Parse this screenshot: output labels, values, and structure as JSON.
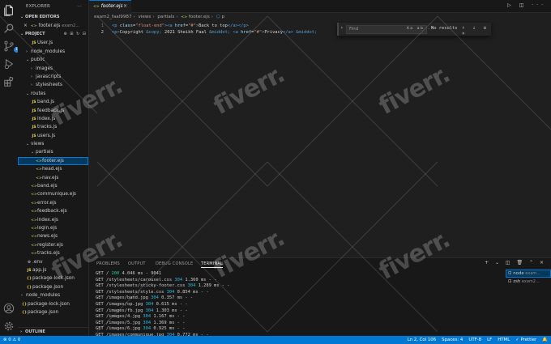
{
  "activity": {
    "items": [
      "files-icon",
      "search-icon",
      "source-control-icon",
      "run-debug-icon",
      "extensions-icon"
    ],
    "bottom": [
      "account-icon",
      "settings-gear-icon"
    ],
    "badge": "1"
  },
  "explorer": {
    "title": "EXPLORER",
    "more": "···",
    "open_editors_label": "OPEN EDITORS",
    "open_editor": {
      "close": "×",
      "name": "footer.ejs",
      "path": "exam2..."
    },
    "project_label": "PROJECT",
    "outline_label": "OUTLINE",
    "tree": [
      {
        "name": "User.js",
        "icon": "JS",
        "kind": "js",
        "depth": 2,
        "chev": ""
      },
      {
        "name": "node_modules",
        "icon": "",
        "kind": "folder",
        "depth": 1,
        "chev": "›"
      },
      {
        "name": "public",
        "icon": "",
        "kind": "folder",
        "depth": 1,
        "chev": "⌄"
      },
      {
        "name": "images",
        "icon": "",
        "kind": "folder",
        "depth": 2,
        "chev": "›"
      },
      {
        "name": "javascripts",
        "icon": "",
        "kind": "folder",
        "depth": 2,
        "chev": "›"
      },
      {
        "name": "stylesheets",
        "icon": "",
        "kind": "folder",
        "depth": 2,
        "chev": "›"
      },
      {
        "name": "routes",
        "icon": "",
        "kind": "folder",
        "depth": 1,
        "chev": "⌄"
      },
      {
        "name": "band.js",
        "icon": "JS",
        "kind": "js",
        "depth": 2,
        "chev": ""
      },
      {
        "name": "feedback.js",
        "icon": "JS",
        "kind": "js",
        "depth": 2,
        "chev": ""
      },
      {
        "name": "index.js",
        "icon": "JS",
        "kind": "js",
        "depth": 2,
        "chev": ""
      },
      {
        "name": "tracks.js",
        "icon": "JS",
        "kind": "js",
        "depth": 2,
        "chev": ""
      },
      {
        "name": "users.js",
        "icon": "JS",
        "kind": "js",
        "depth": 2,
        "chev": ""
      },
      {
        "name": "views",
        "icon": "",
        "kind": "folder",
        "depth": 1,
        "chev": "⌄"
      },
      {
        "name": "partials",
        "icon": "",
        "kind": "folder",
        "depth": 2,
        "chev": "⌄"
      },
      {
        "name": "footer.ejs",
        "icon": "<>",
        "kind": "ejs",
        "depth": 3,
        "chev": "",
        "selected": true
      },
      {
        "name": "head.ejs",
        "icon": "<>",
        "kind": "ejs",
        "depth": 3,
        "chev": ""
      },
      {
        "name": "nav.ejs",
        "icon": "<>",
        "kind": "ejs",
        "depth": 3,
        "chev": ""
      },
      {
        "name": "band.ejs",
        "icon": "<>",
        "kind": "ejs",
        "depth": 2,
        "chev": ""
      },
      {
        "name": "communique.ejs",
        "icon": "<>",
        "kind": "ejs",
        "depth": 2,
        "chev": ""
      },
      {
        "name": "error.ejs",
        "icon": "<>",
        "kind": "ejs",
        "depth": 2,
        "chev": ""
      },
      {
        "name": "feedback.ejs",
        "icon": "<>",
        "kind": "ejs",
        "depth": 2,
        "chev": ""
      },
      {
        "name": "index.ejs",
        "icon": "<>",
        "kind": "ejs",
        "depth": 2,
        "chev": ""
      },
      {
        "name": "login.ejs",
        "icon": "<>",
        "kind": "ejs",
        "depth": 2,
        "chev": ""
      },
      {
        "name": "news.ejs",
        "icon": "<>",
        "kind": "ejs",
        "depth": 2,
        "chev": ""
      },
      {
        "name": "register.ejs",
        "icon": "<>",
        "kind": "ejs",
        "depth": 2,
        "chev": ""
      },
      {
        "name": "tracks.ejs",
        "icon": "<>",
        "kind": "ejs",
        "depth": 2,
        "chev": ""
      },
      {
        "name": ".env",
        "icon": "⚙",
        "kind": "env",
        "depth": 1,
        "chev": ""
      },
      {
        "name": "app.js",
        "icon": "JS",
        "kind": "js",
        "depth": 1,
        "chev": ""
      },
      {
        "name": "package-lock.json",
        "icon": "{}",
        "kind": "json",
        "depth": 1,
        "chev": ""
      },
      {
        "name": "package.json",
        "icon": "{}",
        "kind": "json",
        "depth": 1,
        "chev": ""
      },
      {
        "name": "node_modules",
        "icon": "",
        "kind": "folder",
        "depth": 0,
        "chev": "›"
      },
      {
        "name": "package-lock.json",
        "icon": "{}",
        "kind": "json",
        "depth": 0,
        "chev": ""
      },
      {
        "name": "package.json",
        "icon": "{}",
        "kind": "json",
        "depth": 0,
        "chev": ""
      }
    ]
  },
  "tab": {
    "icon": "<>",
    "name": "footer.ejs",
    "close": "×"
  },
  "tab_actions": "▷ ◫ ···",
  "breadcrumb": [
    "exam2_faal9987",
    "views",
    "partials",
    "footer.ejs",
    "p"
  ],
  "editor": {
    "lines": [
      {
        "num": "1",
        "parts": [
          [
            "tag",
            "<p "
          ],
          [
            "attr",
            "class"
          ],
          [
            "txt",
            "="
          ],
          [
            "str",
            "\"float-end\""
          ],
          [
            "tag",
            "><a "
          ],
          [
            "attr",
            "href"
          ],
          [
            "txt",
            "="
          ],
          [
            "str",
            "\"#\""
          ],
          [
            "tag",
            ">"
          ],
          [
            "txt",
            "Back to top"
          ],
          [
            "tag",
            "</a></p>"
          ]
        ]
      },
      {
        "num": "2",
        "parts": [
          [
            "tag",
            "<p>"
          ],
          [
            "txt",
            "Copyright "
          ],
          [
            "ent",
            "&copy;"
          ],
          [
            "txt",
            " 2021 Sheikh Faal "
          ],
          [
            "ent",
            "&middot;"
          ],
          [
            "txt",
            " "
          ],
          [
            "tag",
            "<a "
          ],
          [
            "attr",
            "href"
          ],
          [
            "txt",
            "="
          ],
          [
            "str",
            "\"#\""
          ],
          [
            "tag",
            ">"
          ],
          [
            "txt",
            "Privacy"
          ],
          [
            "tag",
            "</a>"
          ],
          [
            "txt",
            " "
          ],
          [
            "ent",
            "&middot;"
          ]
        ]
      }
    ]
  },
  "find": {
    "chevron": "›",
    "placeholder": "Find",
    "options": "Aa ab .*",
    "results": "No results",
    "nav": "↑ ↓ ≡ ×"
  },
  "panel": {
    "tabs": [
      "PROBLEMS",
      "OUTPUT",
      "DEBUG CONSOLE",
      "TERMINAL"
    ],
    "actions": "+ ⌄ ◫ 🗑 ⌃ ×",
    "terminal": [
      {
        "pre": "GET / ",
        "code": "200",
        "post": " 4.046 ms - 9041"
      },
      {
        "pre": "GET /stylesheets/carousel.css ",
        "code": "304",
        "post": " 1.360 ms - -"
      },
      {
        "pre": "GET /stylesheets/sticky-footer.css ",
        "code": "304",
        "post": " 1.289 ms - -"
      },
      {
        "pre": "GET /stylesheets/style.css ",
        "code": "304",
        "post": " 0.854 ms - -"
      },
      {
        "pre": "GET /images/band.jpg ",
        "code": "304",
        "post": " 0.357 ms - -"
      },
      {
        "pre": "GET /images/op.jpg ",
        "code": "304",
        "post": " 0.615 ms - -"
      },
      {
        "pre": "GET /images/fb.jpg ",
        "code": "304",
        "post": " 1.303 ms - -"
      },
      {
        "pre": "GET /images/4.jpg ",
        "code": "304",
        "post": " 1.167 ms - -"
      },
      {
        "pre": "GET /images/5.jpg ",
        "code": "304",
        "post": " 1.369 ms - -"
      },
      {
        "pre": "GET /images/6.jpg ",
        "code": "304",
        "post": " 0.925 ms - -"
      },
      {
        "pre": "GET /images/communique.jpg ",
        "code": "304",
        "post": " 0.772 ms - -"
      }
    ],
    "term_list": [
      {
        "name": "node",
        "sub": " exam...",
        "selected": true
      },
      {
        "name": "zsh",
        "sub": " exam2...",
        "selected": false
      }
    ]
  },
  "status": {
    "left": "⊗ 0 ⚠ 0",
    "right": [
      "Ln 2, Col 106",
      "Spaces: 4",
      "UTF-8",
      "LF",
      "HTML",
      "✓ Prettier",
      "🔔"
    ]
  },
  "watermark": "fiverr."
}
